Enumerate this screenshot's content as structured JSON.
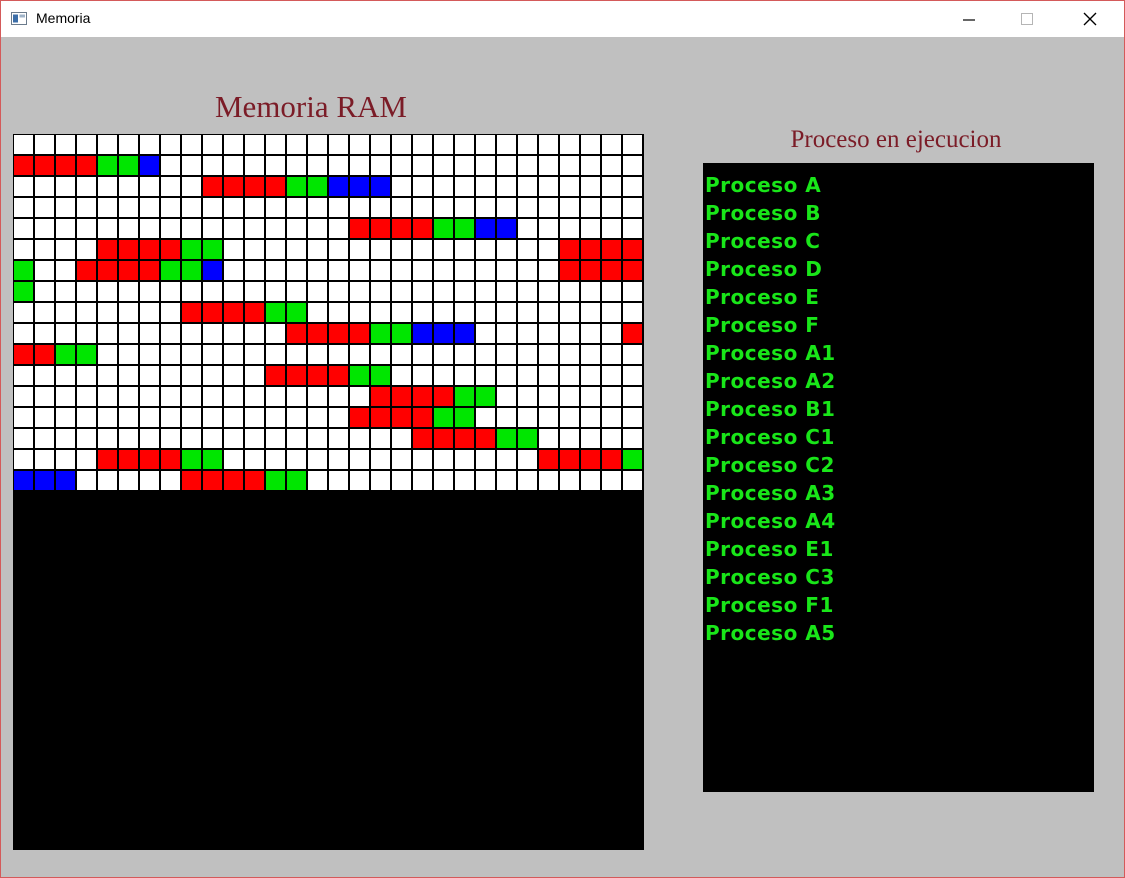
{
  "window": {
    "title": "Memoria",
    "controls": [
      "minimize",
      "maximize",
      "close"
    ]
  },
  "memory": {
    "title": "Memoria RAM",
    "columns": 30,
    "legend_colors": {
      "W": "#ffffff",
      "R": "#ff0000",
      "G": "#00e600",
      "B": "#0000ff"
    },
    "rows": [
      "WWWWWWWWWWWWWWWWWWWWWWWWWWWWWW",
      "RRRRGGBWWWWWWWWWWWWWWWWWWWWWWW",
      "WWWWWWWWWRRRRGGBBBWWWWWWWWWWWW",
      "WWWWWWWWWWWWWWWWWWWWWWWWWWWWWW",
      "WWWWWWWWWWWWWWWWRRRRGGBBWWWWWW",
      "WWWWRRRRGGWWWWWWWWWWWWWWWWRRRRG",
      "GWWRRRRGGBWWWWWWWWWWWWWWWWRRRRG",
      "GWWWWWWWWWWWWWWWWWWWWWWWWWWWWW",
      "WWWWWWWWRRRRGGWWWWWWWWWWWWWWWW",
      "WWWWWWWWWWWWWRRRRGGBBBWWWWWWWRR",
      "RRGGWWWWWWWWWWWWWWWWWWWWWWWWWW",
      "WWWWWWWWWWWWRRRRGGWWWWWWWWWWWW",
      "WWWWWWWWWWWWWWWWWRRRRGGWWWWWWW",
      "WWWWWWWWWWWWWWWWRRRRGGWWWWWWWW",
      "WWWWWWWWWWWWWWWWWWWRRRRGGWWWWW",
      "WWWWRRRRGGWWWWWWWWWWWWWWWRRRRGG",
      "BBBWWWWWRRRRGGWWWWWWWWWWWWWWWW"
    ]
  },
  "processes": {
    "title": "Proceso en ejecucion",
    "items": [
      "Proceso A",
      "Proceso B",
      "Proceso C",
      "Proceso D",
      "Proceso E",
      "Proceso F",
      "Proceso A1",
      "Proceso A2",
      "Proceso B1",
      "Proceso C1",
      "Proceso C2",
      "Proceso A3",
      "Proceso A4",
      "Proceso E1",
      "Proceso C3",
      "Proceso F1",
      "Proceso A5"
    ]
  }
}
